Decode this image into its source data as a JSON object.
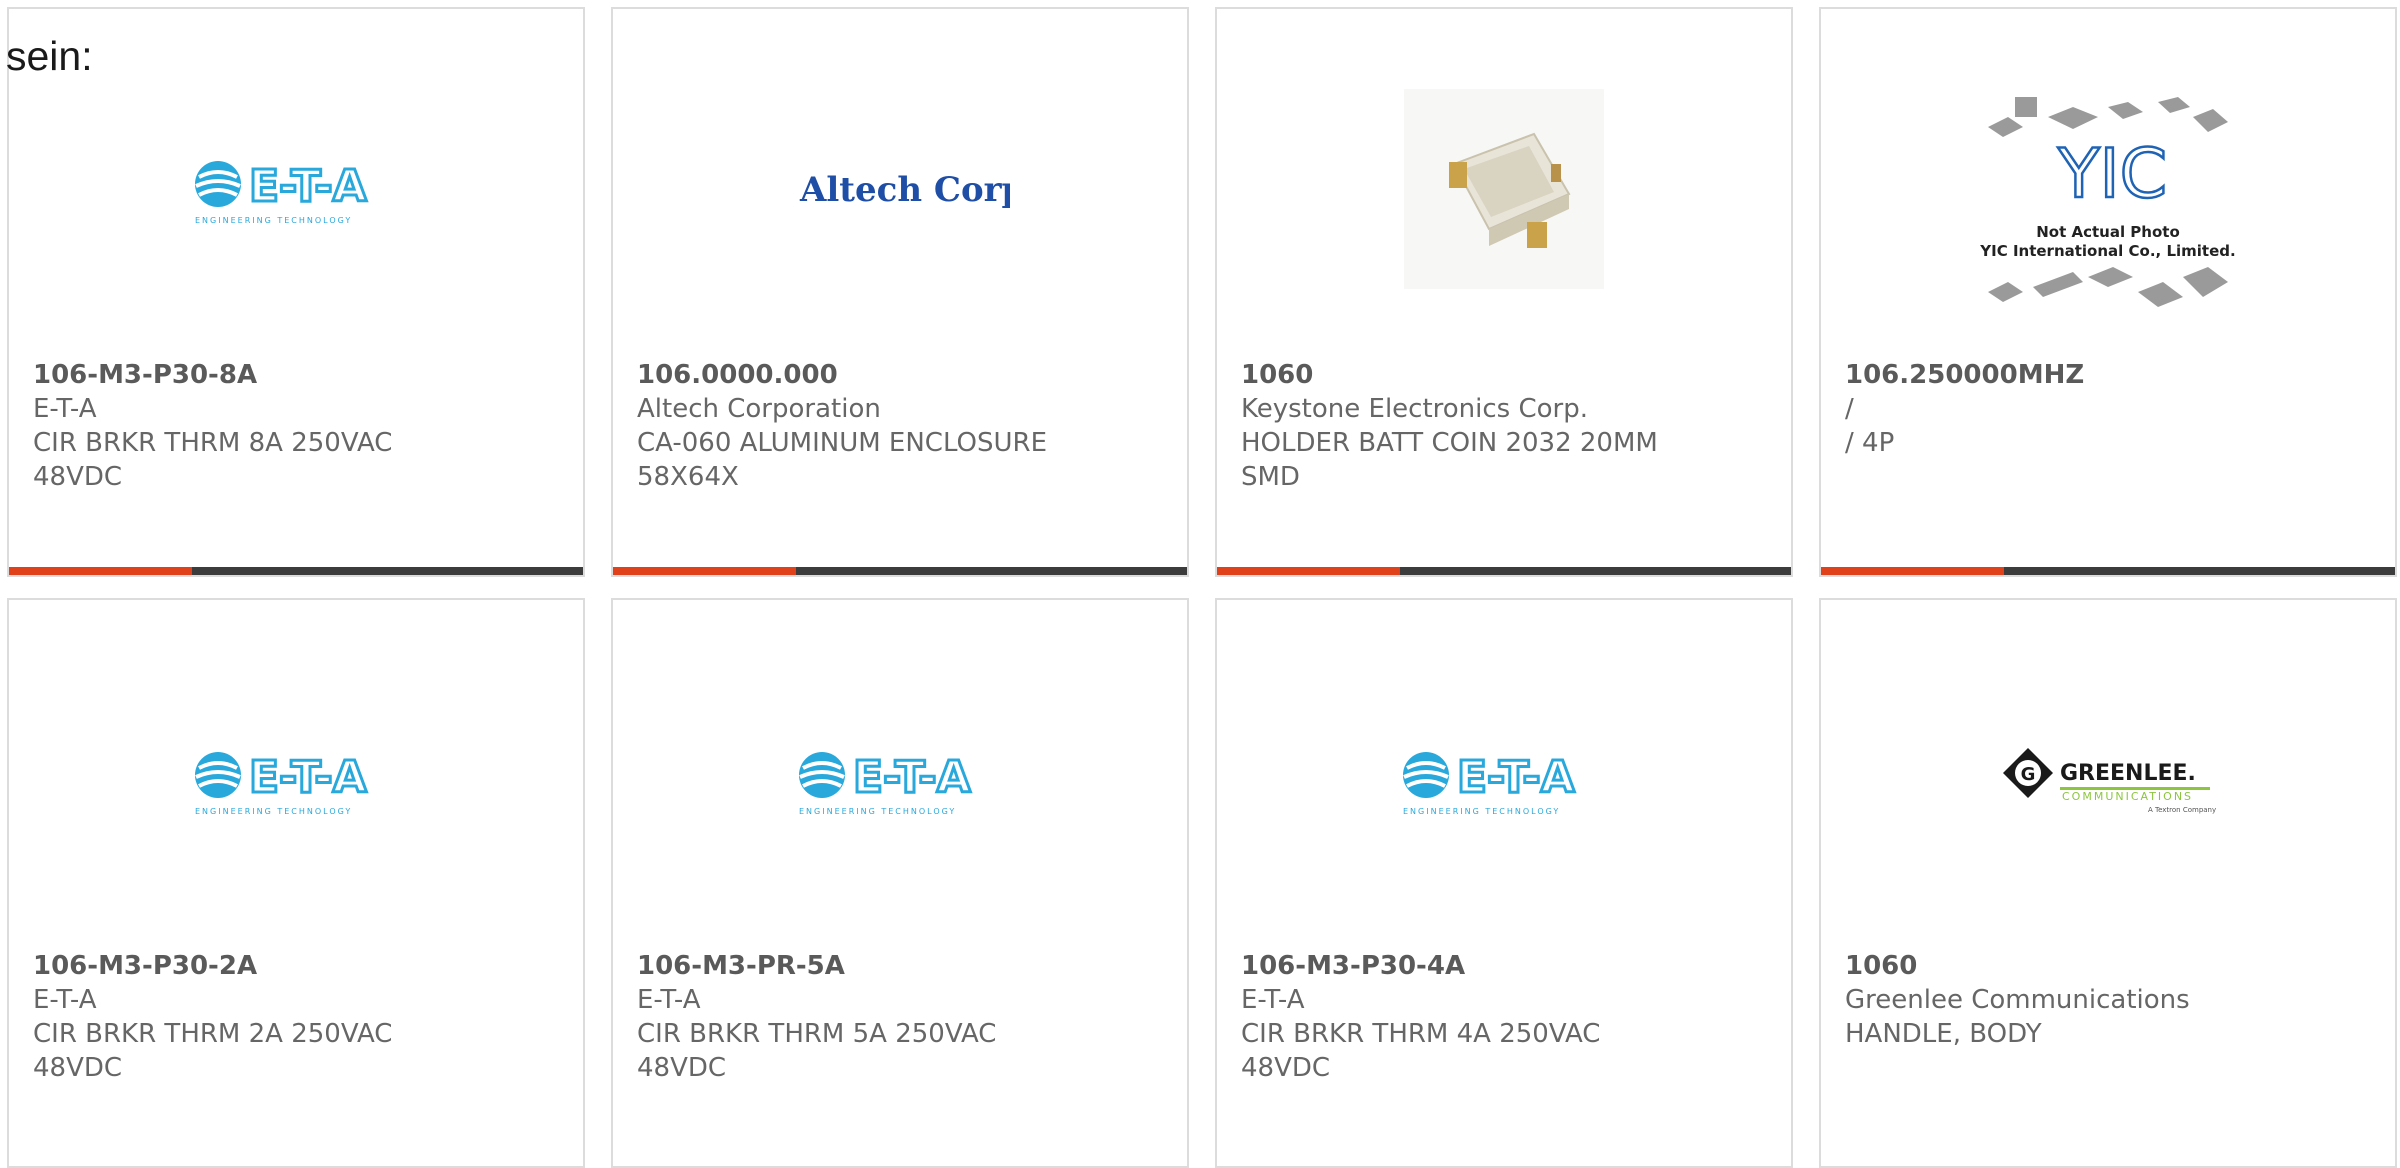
{
  "intro_text": "sein:",
  "colors": {
    "accent": "#e0401a",
    "bar": "#3c3c3c",
    "eta_blue": "#29a8dc",
    "altech_blue": "#1e4ea6"
  },
  "products": [
    {
      "part": "106-M3-P30-8A",
      "maker": "E-T-A",
      "desc1": "CIR BRKR THRM 8A 250VAC",
      "desc2": "48VDC",
      "logo": "E-T-A",
      "logo_sub": "ENGINEERING TECHNOLOGY"
    },
    {
      "part": "106.0000.000",
      "maker": "Altech Corporation",
      "desc1": "CA-060 ALUMINUM ENCLOSURE",
      "desc2": "58X64X",
      "logo": "Altech Corp."
    },
    {
      "part": "1060",
      "maker": "Keystone Electronics Corp.",
      "desc1": "HOLDER BATT COIN 2032 20MM",
      "desc2": "SMD"
    },
    {
      "part": "106.250000MHZ",
      "maker": "/",
      "desc1": "/ 4P",
      "desc2": "",
      "logo": "YIC",
      "logo_line1": "Not Actual Photo",
      "logo_line2": "YIC International Co., Limited."
    },
    {
      "part": "106-M3-P30-2A",
      "maker": "E-T-A",
      "desc1": "CIR BRKR THRM 2A 250VAC",
      "desc2": "48VDC",
      "logo": "E-T-A",
      "logo_sub": "ENGINEERING TECHNOLOGY"
    },
    {
      "part": "106-M3-PR-5A",
      "maker": "E-T-A",
      "desc1": "CIR BRKR THRM 5A 250VAC",
      "desc2": "48VDC",
      "logo": "E-T-A",
      "logo_sub": "ENGINEERING TECHNOLOGY"
    },
    {
      "part": "106-M3-P30-4A",
      "maker": "E-T-A",
      "desc1": "CIR BRKR THRM 4A 250VAC",
      "desc2": "48VDC",
      "logo": "E-T-A",
      "logo_sub": "ENGINEERING TECHNOLOGY"
    },
    {
      "part": "1060",
      "maker": "Greenlee Communications",
      "desc1": "HANDLE, BODY",
      "desc2": "",
      "logo": "GREENLEE.",
      "logo_sub": "COMMUNICATIONS",
      "logo_sub2": "A Textron Company"
    }
  ]
}
